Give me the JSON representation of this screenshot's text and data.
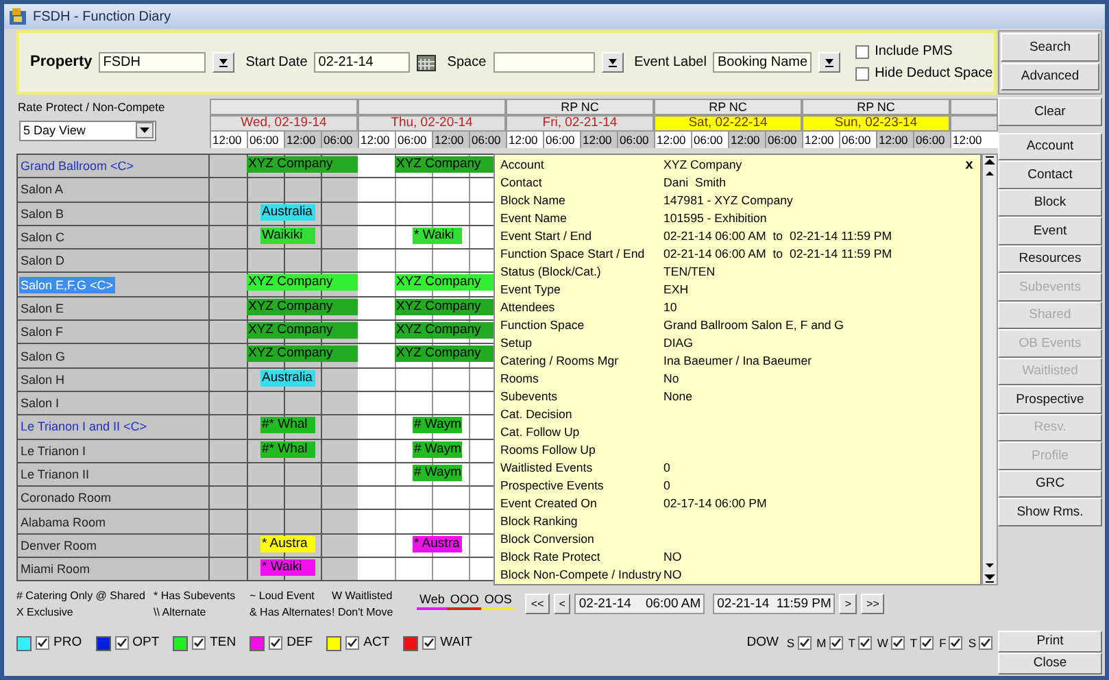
{
  "window": {
    "title": "FSDH - Function Diary"
  },
  "filters": {
    "property": {
      "label": "Property",
      "value": "FSDH"
    },
    "start_date": {
      "label": "Start Date",
      "value": "02-21-14"
    },
    "space": {
      "label": "Space"
    },
    "event_label": {
      "label": "Event Label",
      "value": "Booking Name"
    },
    "options": [
      {
        "label": "Include PMS",
        "checked": false
      },
      {
        "label": "Hide Deduct Space",
        "checked": false
      }
    ]
  },
  "view": {
    "label": "Rate Protect / Non-Compete",
    "value": "5 Day View"
  },
  "days": [
    {
      "date": "Wed, 02-19-14",
      "highlighted": false,
      "times": [
        "12:00",
        "06:00",
        "12:00",
        "06:00"
      ]
    },
    {
      "date": "Thu, 02-20-14",
      "highlighted": false,
      "times": [
        "12:00",
        "06:00",
        "12:00",
        "06:00"
      ]
    },
    {
      "rate_protect": "RP NC",
      "date": "Fri, 02-21-14",
      "highlighted": false,
      "times": [
        "12:00",
        "06:00",
        "12:00",
        "06:00"
      ]
    },
    {
      "rate_protect": "RP NC",
      "date": "Sat, 02-22-14",
      "highlighted": true,
      "times": [
        "12:00",
        "06:00",
        "12:00",
        "06:00"
      ]
    },
    {
      "rate_protect": "RP NC",
      "date": "Sun, 02-23-14",
      "highlighted": true,
      "times": [
        "12:00",
        "06:00",
        "12:00",
        "06:00"
      ]
    }
  ],
  "trailing_time": "12:00",
  "rooms": [
    {
      "name": "Grand Ballroom <C>",
      "combined": true,
      "selected": false,
      "wed": {
        "kind": "full",
        "label": "XYZ Company",
        "color": "#22aa22"
      },
      "thu": {
        "kind": "full",
        "label": "XYZ Company",
        "color": "#22aa22"
      }
    },
    {
      "name": "Salon A",
      "combined": false,
      "selected": false
    },
    {
      "name": "Salon B",
      "combined": false,
      "selected": false,
      "wed": {
        "kind": "short",
        "label": "Australia",
        "color": "#33ddee"
      }
    },
    {
      "name": "Salon C",
      "combined": false,
      "selected": false,
      "wed": {
        "kind": "short",
        "label": "Waikiki",
        "color": "#33dd33"
      },
      "thu": {
        "kind": "short",
        "label": "* Waiki",
        "color": "#33dd33"
      }
    },
    {
      "name": "Salon D",
      "combined": false,
      "selected": false
    },
    {
      "name": "Salon E,F,G <C>",
      "combined": true,
      "selected": true,
      "wed": {
        "kind": "full",
        "label": "XYZ Company",
        "color": "#33ee33"
      },
      "thu": {
        "kind": "full",
        "label": "XYZ Company",
        "color": "#33ee33"
      }
    },
    {
      "name": "Salon E",
      "combined": false,
      "selected": false,
      "wed": {
        "kind": "full",
        "label": "XYZ Company",
        "color": "#22aa22"
      },
      "thu": {
        "kind": "full",
        "label": "XYZ Company",
        "color": "#22aa22"
      }
    },
    {
      "name": "Salon F",
      "combined": false,
      "selected": false,
      "wed": {
        "kind": "full",
        "label": "XYZ Company",
        "color": "#22aa22"
      },
      "thu": {
        "kind": "full",
        "label": "XYZ Company",
        "color": "#22aa22"
      }
    },
    {
      "name": "Salon G",
      "combined": false,
      "selected": false,
      "wed": {
        "kind": "full",
        "label": "XYZ Company",
        "color": "#22aa22"
      },
      "thu": {
        "kind": "full",
        "label": "XYZ Company",
        "color": "#22aa22"
      }
    },
    {
      "name": "Salon H",
      "combined": false,
      "selected": false,
      "wed": {
        "kind": "short",
        "label": "Australia",
        "color": "#33ddee"
      }
    },
    {
      "name": "Salon I",
      "combined": false,
      "selected": false
    },
    {
      "name": "Le Trianon I and II <C>",
      "combined": true,
      "selected": false,
      "wed": {
        "kind": "short",
        "label": "#* Whal",
        "color": "#22bb22"
      },
      "thu": {
        "kind": "short",
        "label": "# Waym",
        "color": "#22bb22"
      }
    },
    {
      "name": "Le Trianon I",
      "combined": false,
      "selected": false,
      "wed": {
        "kind": "short",
        "label": "#* Whal",
        "color": "#22bb22"
      },
      "thu": {
        "kind": "short",
        "label": "# Waym",
        "color": "#22bb22"
      }
    },
    {
      "name": "Le Trianon II",
      "combined": false,
      "selected": false,
      "thu": {
        "kind": "short",
        "label": "# Waym",
        "color": "#22bb22"
      }
    },
    {
      "name": "Coronado Room",
      "combined": false,
      "selected": false
    },
    {
      "name": "Alabama Room",
      "combined": false,
      "selected": false
    },
    {
      "name": "Denver Room",
      "combined": false,
      "selected": false,
      "wed": {
        "kind": "short",
        "label": "* Austra",
        "color": "#ffff00"
      },
      "thu": {
        "kind": "short",
        "label": "* Austra",
        "color": "#ee11ee"
      }
    },
    {
      "name": "Miami Room",
      "combined": false,
      "selected": false,
      "wed": {
        "kind": "short",
        "label": "* Waiki",
        "color": "#ee11ee"
      }
    }
  ],
  "details": [
    {
      "label": "Account",
      "value": "XYZ Company"
    },
    {
      "label": "Contact",
      "value": "Dani  Smith"
    },
    {
      "label": "Block Name",
      "value": "147981 - XYZ Company"
    },
    {
      "label": "Event Name",
      "value": "101595 - Exhibition"
    },
    {
      "label": "Event Start / End",
      "value": "02-21-14 06:00 AM  to  02-21-14 11:59 PM"
    },
    {
      "label": "Function Space Start / End",
      "value": "02-21-14 06:00 AM  to  02-21-14 11:59 PM"
    },
    {
      "label": "Status (Block/Cat.)",
      "value": "TEN/TEN"
    },
    {
      "label": "Event Type",
      "value": "EXH"
    },
    {
      "label": "Attendees",
      "value": "10"
    },
    {
      "label": "Function Space",
      "value": "Grand Ballroom Salon E, F and G"
    },
    {
      "label": "Setup",
      "value": "DIAG"
    },
    {
      "label": "Catering / Rooms Mgr",
      "value": "Ina Baeumer / Ina Baeumer"
    },
    {
      "label": "Rooms",
      "value": "No"
    },
    {
      "label": "Subevents",
      "value": "None"
    },
    {
      "label": "Cat. Decision"
    },
    {
      "label": "Cat. Follow Up"
    },
    {
      "label": "Rooms Follow Up"
    },
    {
      "label": "Waitlisted Events",
      "value": "0"
    },
    {
      "label": "Prospective Events",
      "value": "0"
    },
    {
      "label": "Event Created On",
      "value": "02-17-14 06:00 PM"
    },
    {
      "label": "Block Ranking"
    },
    {
      "label": "Block Conversion"
    },
    {
      "label": "Block Rate Protect",
      "value": "NO"
    },
    {
      "label": "Block Non-Compete / Industry",
      "value": "NO"
    }
  ],
  "details_close": "x",
  "legend": {
    "symbols": [
      "# Catering Only @ Shared",
      "* Has Subevents",
      "~ Loud Event",
      "W Waitlisted",
      "X Exclusive",
      "\\\\ Alternate",
      "& Has Alternates",
      "! Don't Move"
    ],
    "markers": [
      {
        "label": "Web",
        "color": "#e020e0"
      },
      {
        "label": "OOO",
        "color": "#dd2222"
      },
      {
        "label": "OOS",
        "color": "#eeee22"
      }
    ]
  },
  "navigation": {
    "back": [
      "<<",
      "<"
    ],
    "from": "02-21-14    06:00 AM",
    "to": "02-21-14  11:59 PM",
    "forward": [
      ">",
      ">>"
    ]
  },
  "statuses": [
    {
      "label": "PRO",
      "color": "#33eeff",
      "checked": true
    },
    {
      "label": "OPT",
      "color": "#0022dd",
      "checked": true
    },
    {
      "label": "TEN",
      "color": "#22ee22",
      "checked": true
    },
    {
      "label": "DEF",
      "color": "#ee11ee",
      "checked": true
    },
    {
      "label": "ACT",
      "color": "#ffff00",
      "checked": true
    },
    {
      "label": "WAIT",
      "color": "#ee1111",
      "checked": true
    }
  ],
  "dow": {
    "label": "DOW",
    "days": [
      {
        "label": "S",
        "checked": true
      },
      {
        "label": "M",
        "checked": true
      },
      {
        "label": "T",
        "checked": true
      },
      {
        "label": "W",
        "checked": true
      },
      {
        "label": "T",
        "checked": true
      },
      {
        "label": "F",
        "checked": true
      },
      {
        "label": "S",
        "checked": true
      }
    ]
  },
  "actions_top": [
    {
      "label": "Search",
      "disabled": false
    },
    {
      "label": "Advanced",
      "disabled": false
    },
    {
      "label": "Clear",
      "disabled": false
    }
  ],
  "actions": [
    {
      "label": "Account",
      "disabled": false
    },
    {
      "label": "Contact",
      "disabled": false
    },
    {
      "label": "Block",
      "disabled": false
    },
    {
      "label": "Event",
      "disabled": false
    },
    {
      "label": "Resources",
      "disabled": false
    },
    {
      "label": "Subevents",
      "disabled": true
    },
    {
      "label": "Shared",
      "disabled": true
    },
    {
      "label": "OB Events",
      "disabled": true
    },
    {
      "label": "Waitlisted",
      "disabled": true
    },
    {
      "label": "Prospective",
      "disabled": false
    },
    {
      "label": "Resv.",
      "disabled": true
    },
    {
      "label": "Profile",
      "disabled": true
    },
    {
      "label": "GRC",
      "disabled": false
    },
    {
      "label": "Show Rms.",
      "disabled": false
    }
  ],
  "actions_bottom": [
    {
      "label": "Print",
      "disabled": false
    },
    {
      "label": "Close",
      "disabled": false
    }
  ]
}
